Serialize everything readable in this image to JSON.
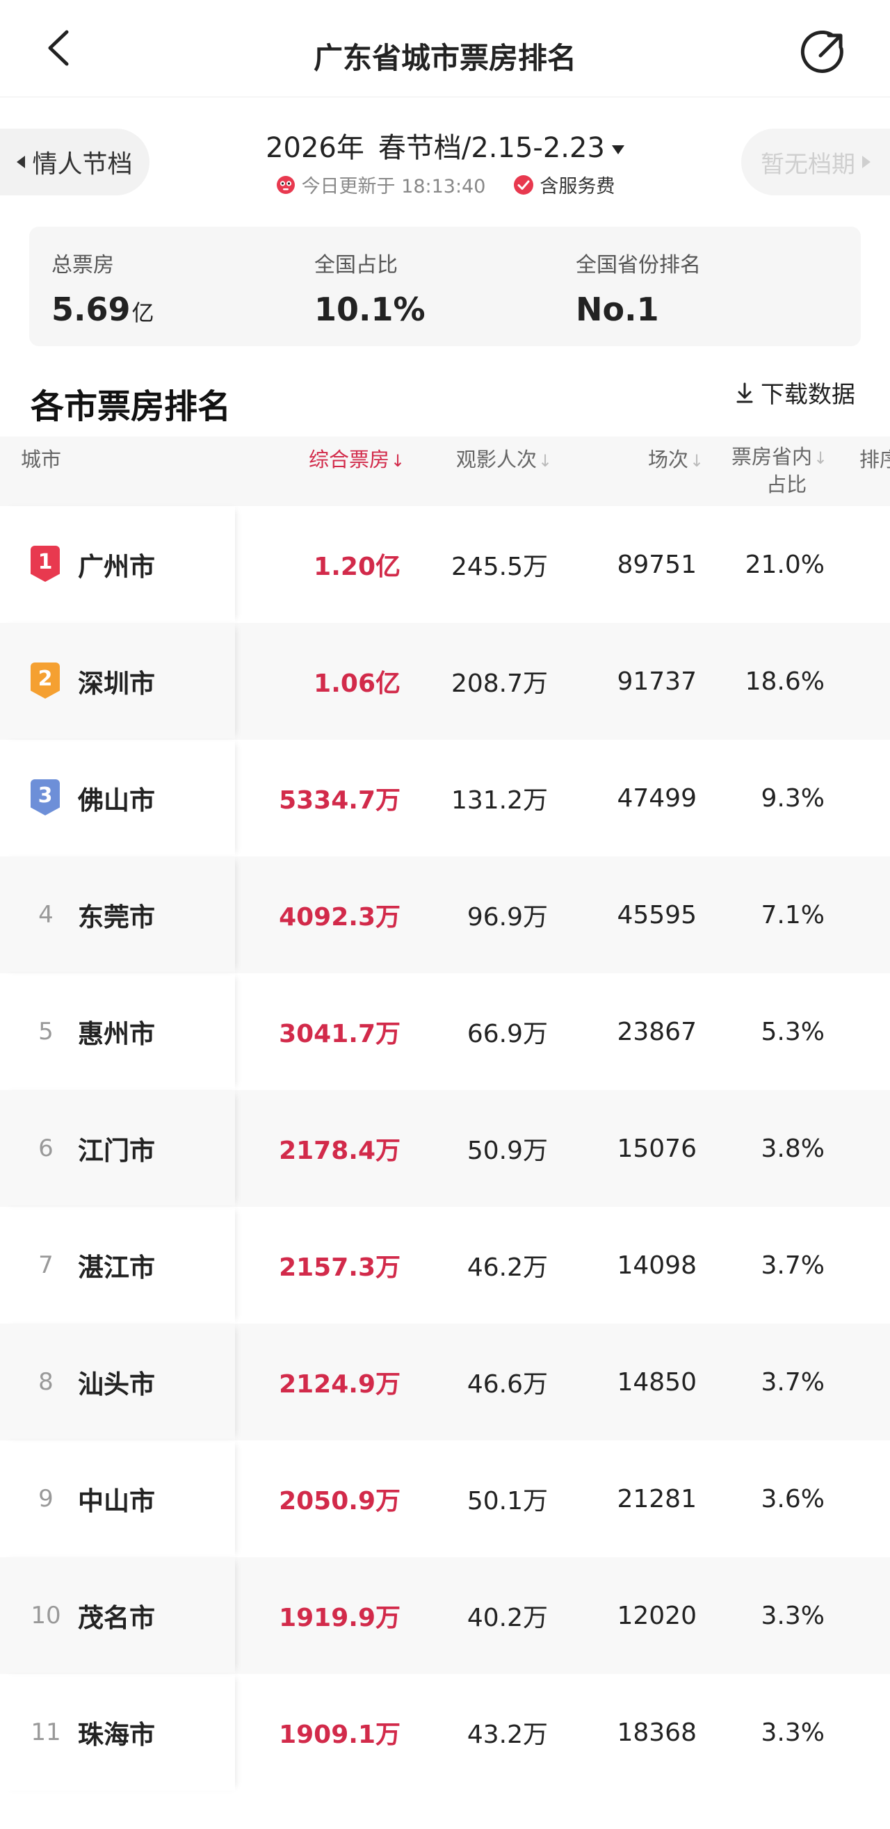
{
  "header": {
    "title": "广东省城市票房排名"
  },
  "period": {
    "prev_label": "情人节档",
    "year": "2026年",
    "current_label": "春节档/2.15-2.23",
    "next_label": "暂无档期",
    "updated_text": "今日更新于 18:13:40",
    "fee_text": "含服务费"
  },
  "summary": {
    "total_label": "总票房",
    "total_value": "5.69",
    "total_unit": "亿",
    "national_share_label": "全国占比",
    "national_share_value": "10.1%",
    "province_rank_label": "全国省份排名",
    "province_rank_value": "No.1"
  },
  "section": {
    "title": "各市票房排名",
    "download_label": "下载数据"
  },
  "table": {
    "headers": {
      "city": "城市",
      "box_office": "综合票房",
      "audience": "观影人次",
      "shows": "场次",
      "province_share_line1": "票房省内",
      "province_share_line2": "占比",
      "rank": "排序"
    },
    "rows": [
      {
        "rank": "1",
        "city": "广州市",
        "box_office": "1.20亿",
        "audience": "245.5万",
        "shows": "89751",
        "share": "21.0%",
        "medal_color": "#e8394f"
      },
      {
        "rank": "2",
        "city": "深圳市",
        "box_office": "1.06亿",
        "audience": "208.7万",
        "shows": "91737",
        "share": "18.6%",
        "medal_color": "#f5a031"
      },
      {
        "rank": "3",
        "city": "佛山市",
        "box_office": "5334.7万",
        "audience": "131.2万",
        "shows": "47499",
        "share": "9.3%",
        "medal_color": "#6d8fd8"
      },
      {
        "rank": "4",
        "city": "东莞市",
        "box_office": "4092.3万",
        "audience": "96.9万",
        "shows": "45595",
        "share": "7.1%"
      },
      {
        "rank": "5",
        "city": "惠州市",
        "box_office": "3041.7万",
        "audience": "66.9万",
        "shows": "23867",
        "share": "5.3%"
      },
      {
        "rank": "6",
        "city": "江门市",
        "box_office": "2178.4万",
        "audience": "50.9万",
        "shows": "15076",
        "share": "3.8%"
      },
      {
        "rank": "7",
        "city": "湛江市",
        "box_office": "2157.3万",
        "audience": "46.2万",
        "shows": "14098",
        "share": "3.7%"
      },
      {
        "rank": "8",
        "city": "汕头市",
        "box_office": "2124.9万",
        "audience": "46.6万",
        "shows": "14850",
        "share": "3.7%"
      },
      {
        "rank": "9",
        "city": "中山市",
        "box_office": "2050.9万",
        "audience": "50.1万",
        "shows": "21281",
        "share": "3.6%"
      },
      {
        "rank": "10",
        "city": "茂名市",
        "box_office": "1919.9万",
        "audience": "40.2万",
        "shows": "12020",
        "share": "3.3%"
      },
      {
        "rank": "11",
        "city": "珠海市",
        "box_office": "1909.1万",
        "audience": "43.2万",
        "shows": "18368",
        "share": "3.3%"
      }
    ]
  },
  "colors": {
    "accent": "#d22a4a"
  }
}
